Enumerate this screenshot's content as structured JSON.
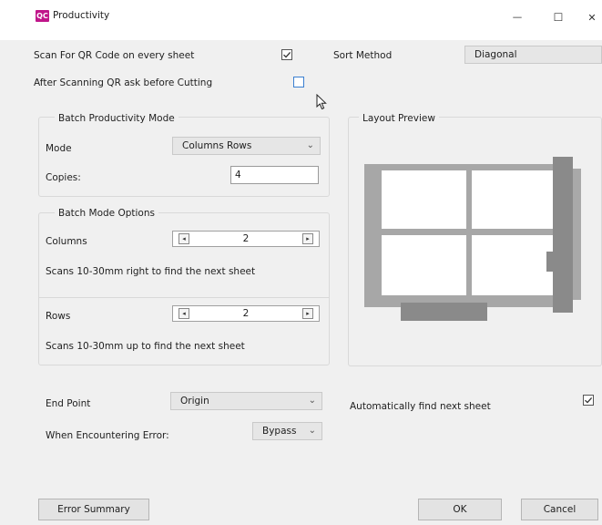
{
  "window": {
    "logo_text": "QC",
    "title": "Productivity",
    "minimize": "—",
    "maximize": "☐",
    "close": "✕"
  },
  "top": {
    "scan_qr_label": "Scan For QR Code on every sheet",
    "scan_qr_checked": true,
    "ask_before_cutting_label": "After Scanning QR ask before Cutting",
    "ask_before_cutting_checked": false,
    "sort_method_label": "Sort Method",
    "sort_method_value": "Diagonal"
  },
  "batch_mode": {
    "title": "Batch Productivity Mode",
    "mode_label": "Mode",
    "mode_value": "Columns  Rows",
    "copies_label": "Copies:",
    "copies_value": "4"
  },
  "batch_options": {
    "title": "Batch Mode Options",
    "columns_label": "Columns",
    "columns_value": "2",
    "columns_hint": "Scans 10-30mm right to find the next sheet",
    "rows_label": "Rows",
    "rows_value": "2",
    "rows_hint": "Scans 10-30mm up to find the next sheet"
  },
  "layout_preview": {
    "title": "Layout Preview",
    "columns": 2,
    "rows": 2
  },
  "end_point": {
    "label": "End Point",
    "value": "Origin"
  },
  "error": {
    "label": "When Encountering Error:",
    "value": "Bypass"
  },
  "auto_find": {
    "label": "Automatically find next sheet",
    "checked": true
  },
  "buttons": {
    "error_summary": "Error Summary",
    "ok": "OK",
    "cancel": "Cancel"
  },
  "icons": {
    "chevron": "chevron-down-icon",
    "spin_left": "◂",
    "spin_right": "▸",
    "check": "✓"
  }
}
